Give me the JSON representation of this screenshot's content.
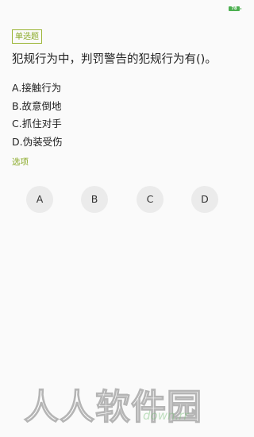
{
  "status_bar": {
    "battery_icon": "battery-icon",
    "battery_level": "78"
  },
  "question": {
    "type_badge": "单选题",
    "text": "犯规行为中，判罚警告的犯规行为有()。",
    "options": [
      "A.接触行为",
      "B.故意倒地",
      "C.抓住对手",
      "D.伪装受伤"
    ]
  },
  "answer_section": {
    "label": "选项",
    "buttons": [
      "A",
      "B",
      "C",
      "D"
    ]
  },
  "watermark": {
    "text": "人人软件园",
    "sub": "down.rr"
  },
  "colors": {
    "accent": "#8aaa28",
    "battery": "#4caf50",
    "button_bg": "#ebebeb",
    "page_bg": "#fafafa"
  }
}
